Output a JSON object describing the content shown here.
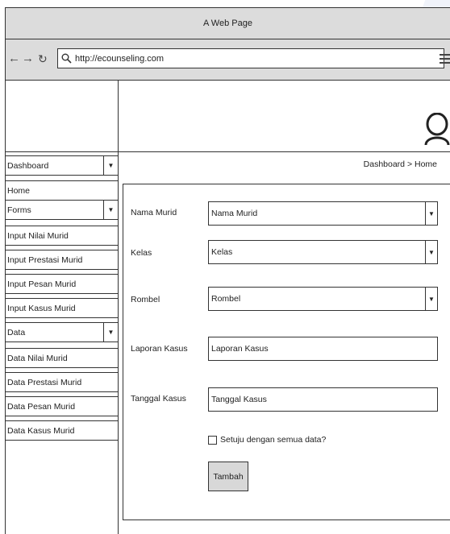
{
  "window": {
    "title": "A Web Page"
  },
  "browser": {
    "back_icon": "arrow-left-icon",
    "forward_icon": "arrow-right-icon",
    "reload_icon": "reload-icon",
    "search_icon": "search-icon",
    "url": "http://ecounseling.com",
    "menu_icon": "hamburger-icon"
  },
  "header": {
    "avatar_icon": "user-avatar-icon"
  },
  "breadcrumb": "Dashboard > Home",
  "sidebar": {
    "items": [
      {
        "label": "Dashboard",
        "dropdown": true
      },
      {
        "label": "Home",
        "dropdown": false
      },
      {
        "label": "Forms",
        "dropdown": true
      },
      {
        "label": "Input Nilai Murid",
        "dropdown": false
      },
      {
        "label": "Input Prestasi Murid",
        "dropdown": false
      },
      {
        "label": "Input Pesan Murid",
        "dropdown": false
      },
      {
        "label": "Input Kasus Murid",
        "dropdown": false
      },
      {
        "label": "Data",
        "dropdown": true
      },
      {
        "label": "Data Nilai Murid",
        "dropdown": false
      },
      {
        "label": "Data Prestasi Murid",
        "dropdown": false
      },
      {
        "label": "Data Pesan Murid",
        "dropdown": false
      },
      {
        "label": "Data Kasus Murid",
        "dropdown": false
      }
    ]
  },
  "form": {
    "nama_murid": {
      "label": "Nama Murid",
      "value": "Nama Murid"
    },
    "kelas": {
      "label": "Kelas",
      "value": "Kelas"
    },
    "rombel": {
      "label": "Rombel",
      "value": "Rombel"
    },
    "laporan_kasus": {
      "label": "Laporan Kasus",
      "value": "Laporan Kasus"
    },
    "tanggal_kasus": {
      "label": "Tanggal Kasus",
      "value": "Tanggal Kasus"
    },
    "agree": {
      "label": "Setuju dengan semua data?",
      "checked": false
    },
    "submit_label": "Tambah"
  },
  "colors": {
    "chrome": "#dcdcdc",
    "button": "#d8d8d8",
    "border": "#333333"
  }
}
